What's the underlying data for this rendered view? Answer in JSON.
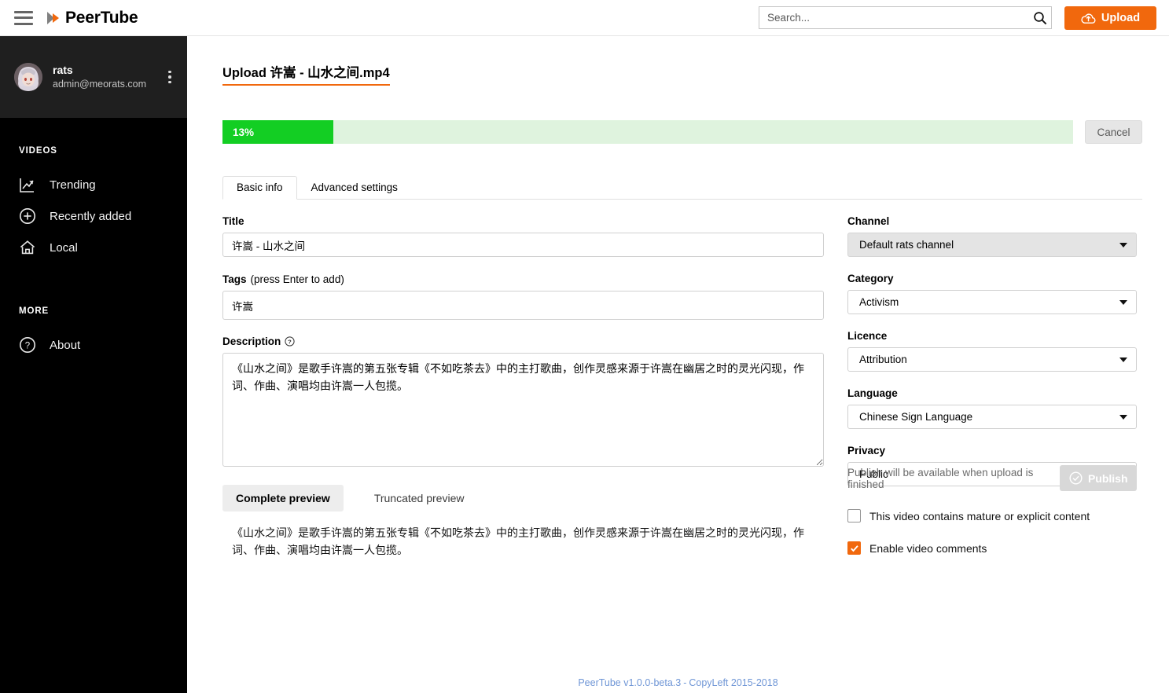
{
  "brand": {
    "name": "PeerTube",
    "accent": "#f1680d",
    "logo_icon": "peertube-play-logo"
  },
  "header": {
    "menu_icon": "hamburger-menu-icon",
    "search": {
      "placeholder": "Search...",
      "value": "",
      "icon": "search-icon"
    },
    "upload_button": {
      "label": "Upload",
      "icon": "cloud-upload-icon"
    }
  },
  "sidebar": {
    "account": {
      "display_name": "rats",
      "handle": "admin@meorats.com",
      "avatar_icon": "user-avatar",
      "menu_icon": "vertical-dots-icon"
    },
    "sections": [
      {
        "heading": "VIDEOS",
        "items": [
          {
            "label": "Trending",
            "icon": "trending-chart-icon"
          },
          {
            "label": "Recently added",
            "icon": "plus-circle-icon"
          },
          {
            "label": "Local",
            "icon": "home-icon"
          }
        ]
      },
      {
        "heading": "MORE",
        "items": [
          {
            "label": "About",
            "icon": "question-circle-icon"
          }
        ]
      }
    ]
  },
  "main": {
    "page_title": "Upload 许嵩 - 山水之间.mp4",
    "upload": {
      "progress_percent": 13,
      "progress_label": "13%",
      "progress_color": "#13ce23",
      "progress_track_color": "#dff3de",
      "cancel_label": "Cancel"
    },
    "tabs": [
      {
        "label": "Basic info",
        "active": true
      },
      {
        "label": "Advanced settings",
        "active": false
      }
    ],
    "form": {
      "title": {
        "label": "Title",
        "value": "许嵩 - 山水之间"
      },
      "tags": {
        "label": "Tags",
        "hint": "(press Enter to add)",
        "value": "许嵩"
      },
      "description": {
        "label": "Description",
        "help_icon": "question-circle-icon",
        "value": "《山水之间》是歌手许嵩的第五张专辑《不如吃茶去》中的主打歌曲，创作灵感来源于许嵩在幽居之时的灵光闪现，作词、作曲、演唱均由许嵩一人包揽。"
      },
      "preview": {
        "complete_label": "Complete preview",
        "truncated_label": "Truncated preview",
        "active": "complete",
        "text": "《山水之间》是歌手许嵩的第五张专辑《不如吃茶去》中的主打歌曲，创作灵感来源于许嵩在幽居之时的灵光闪现，作词、作曲、演唱均由许嵩一人包揽。"
      },
      "channel": {
        "label": "Channel",
        "value": "Default rats channel",
        "disabled": true
      },
      "category": {
        "label": "Category",
        "value": "Activism"
      },
      "licence": {
        "label": "Licence",
        "value": "Attribution"
      },
      "language": {
        "label": "Language",
        "value": "Chinese Sign Language"
      },
      "privacy": {
        "label": "Privacy",
        "value": "Public"
      },
      "mature_checkbox": {
        "label": "This video contains mature or explicit content",
        "checked": false
      },
      "comments_checkbox": {
        "label": "Enable video comments",
        "checked": true
      }
    },
    "publish": {
      "note": "Publish will be available when upload is finished",
      "button_label": "Publish",
      "button_icon": "check-circle-icon",
      "disabled": true
    }
  },
  "footer": {
    "version_link": "PeerTube v1.0.0-beta.3",
    "separator": "-",
    "copyleft": "CopyLeft 2015-2018"
  }
}
